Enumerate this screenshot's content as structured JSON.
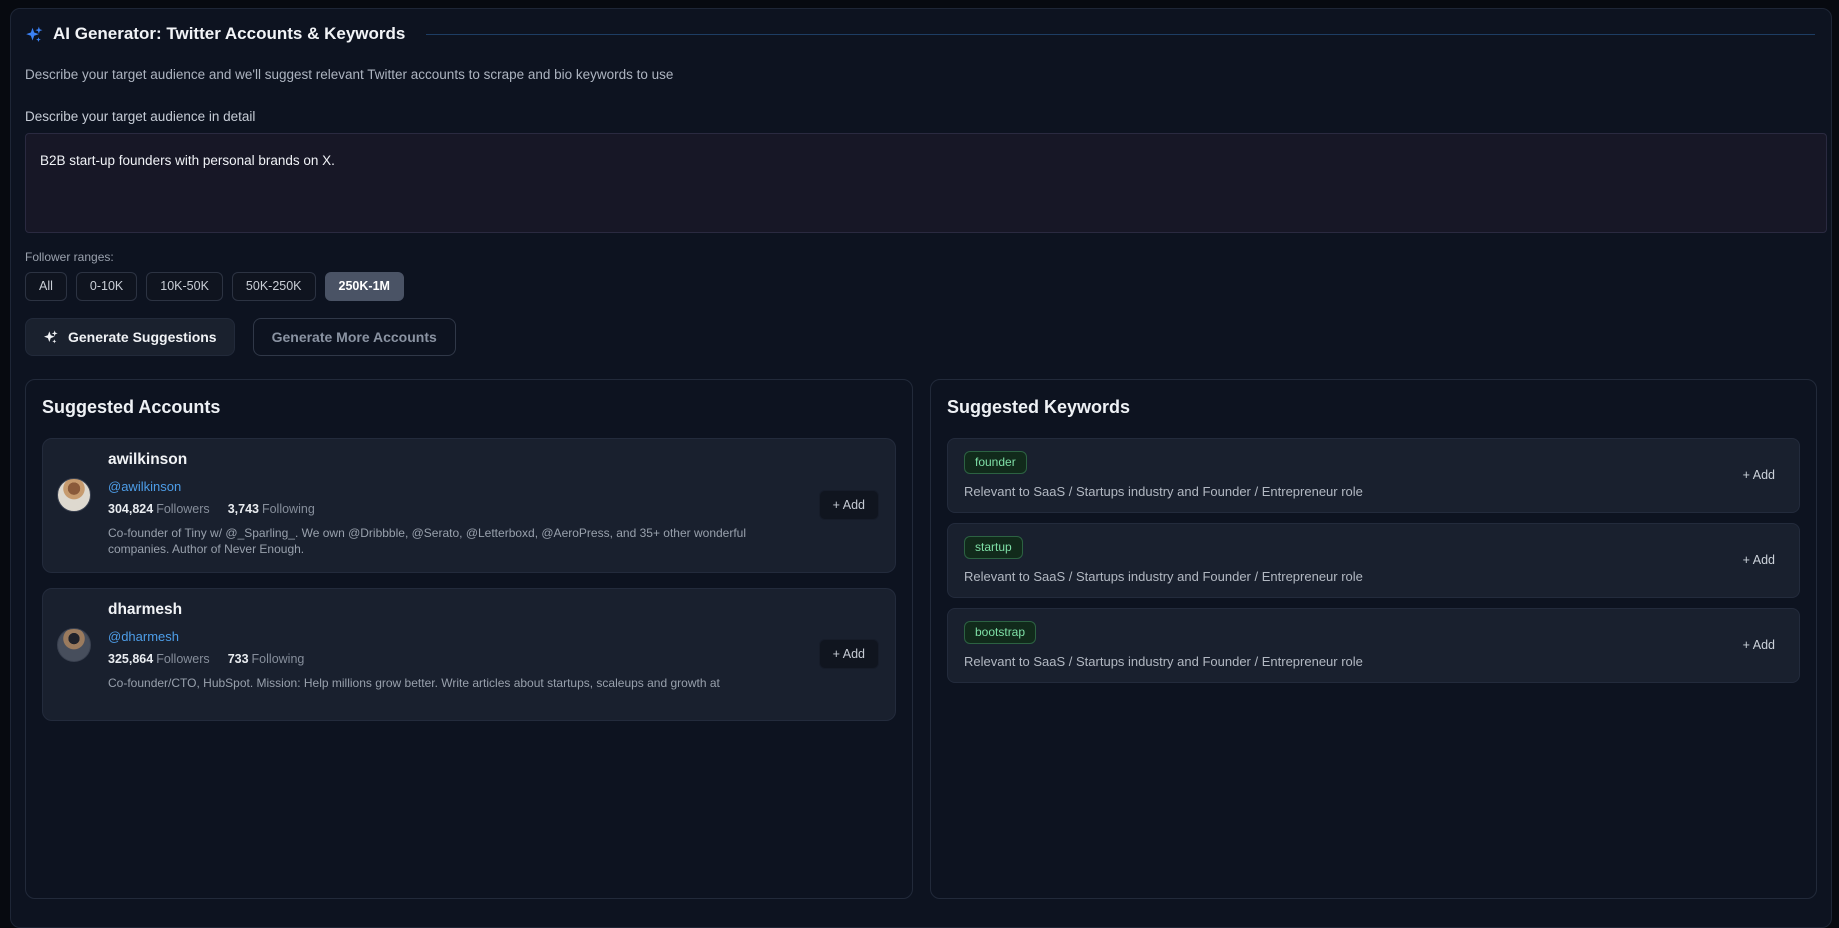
{
  "header": {
    "title": "AI Generator: Twitter Accounts & Keywords",
    "description": "Describe your target audience and we'll suggest relevant Twitter accounts to scrape and bio keywords to use",
    "accent_color": "#3b82f6",
    "divider_color": "#1d3d63"
  },
  "audience": {
    "label": "Describe your target audience in detail",
    "value": "B2B start-up founders with personal brands on X."
  },
  "follower_ranges": {
    "label": "Follower ranges:",
    "options": [
      {
        "label": "All",
        "selected": false
      },
      {
        "label": "0-10K",
        "selected": false
      },
      {
        "label": "10K-50K",
        "selected": false
      },
      {
        "label": "50K-250K",
        "selected": false
      },
      {
        "label": "250K-1M",
        "selected": true
      }
    ],
    "selected_color": "#4a5365"
  },
  "actions": {
    "generate_label": "Generate Suggestions",
    "generate_more_label": "Generate More Accounts"
  },
  "accounts_panel": {
    "title": "Suggested Accounts",
    "add_label": "+ Add",
    "handle_color": "#4d9de8",
    "accounts": [
      {
        "name": "awilkinson",
        "handle": "@awilkinson",
        "followers_count": "304,824",
        "followers_label": "Followers",
        "following_count": "3,743",
        "following_label": "Following",
        "bio": "Co-founder of Tiny w/ @_Sparling_. We own @Dribbble, @Serato, @Letterboxd, @AeroPress, and 35+ other wonderful companies. Author of Never Enough."
      },
      {
        "name": "dharmesh",
        "handle": "@dharmesh",
        "followers_count": "325,864",
        "followers_label": "Followers",
        "following_count": "733",
        "following_label": "Following",
        "bio": "Co-founder/CTO, HubSpot. Mission: Help millions grow better. Write articles about startups, scaleups and growth at"
      }
    ]
  },
  "keywords_panel": {
    "title": "Suggested Keywords",
    "add_label": "+ Add",
    "badge_color": "#7fe0a7",
    "keywords": [
      {
        "keyword": "founder",
        "description": "Relevant to SaaS / Startups industry and Founder / Entrepreneur role"
      },
      {
        "keyword": "startup",
        "description": "Relevant to SaaS / Startups industry and Founder / Entrepreneur role"
      },
      {
        "keyword": "bootstrap",
        "description": "Relevant to SaaS / Startups industry and Founder / Entrepreneur role"
      }
    ]
  }
}
